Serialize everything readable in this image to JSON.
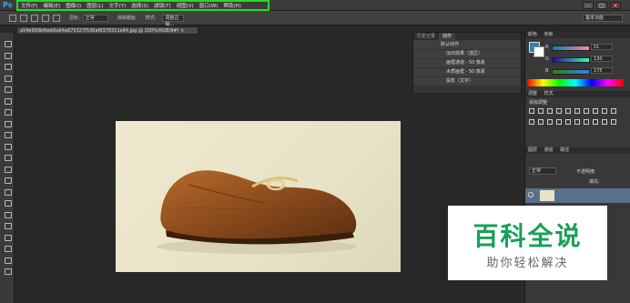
{
  "app": {
    "logo": "Ps",
    "highlight_color": "#22dd22"
  },
  "menu": {
    "items": [
      "文件(F)",
      "编辑(E)",
      "图像(I)",
      "图层(L)",
      "文字(Y)",
      "选择(S)",
      "滤镜(T)",
      "视图(V)",
      "窗口(W)",
      "帮助(H)"
    ]
  },
  "window_controls": {
    "minimize": "–",
    "maximize": "□",
    "close": "×"
  },
  "options_bar": {
    "feather_label": "羽化:",
    "feather_value": "正常",
    "antialias_label": "消除锯齿",
    "mode_label": "样式:",
    "refine_button": "调整边缘...",
    "workspace": "基本功能"
  },
  "document": {
    "tab_title": "a54e959bfbeb6a64a675327f536af6378311e84.jpg @ 100%(RGB/8#) ×"
  },
  "actions_panel": {
    "tabs": [
      "历史记录",
      "动作"
    ],
    "rows": [
      "默认动作",
      "淡出效果（选区）",
      "画框通道 - 50 像素",
      "木质画框 - 50 像素",
      "投影（文字）"
    ]
  },
  "color_panel": {
    "tabs": [
      "颜色",
      "色板"
    ],
    "channels": [
      {
        "label": "R",
        "value": "51"
      },
      {
        "label": "G",
        "value": "130"
      },
      {
        "label": "B",
        "value": "175"
      }
    ],
    "foreground": "#3382af"
  },
  "adjustments_panel": {
    "tabs": [
      "调整",
      "样式"
    ],
    "title": "添加调整"
  },
  "layers_panel": {
    "tabs": [
      "图层",
      "通道",
      "路径"
    ],
    "blend_mode": "正常",
    "opacity_label": "不透明度:",
    "fill_label": "填充:"
  },
  "watermark": {
    "title": "百科全说",
    "subtitle": "助你轻松解决"
  }
}
